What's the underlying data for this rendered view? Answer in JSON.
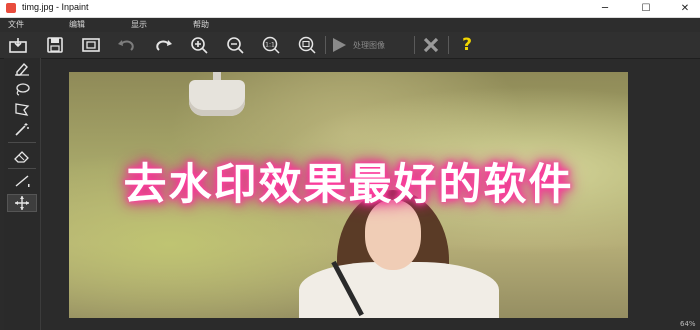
{
  "window": {
    "title": "timg.jpg - Inpaint",
    "minimize": "─",
    "maximize": "☐",
    "close": "✕"
  },
  "menu": {
    "items": [
      "文件",
      "编辑",
      "显示",
      "帮助"
    ]
  },
  "toolbar": {
    "icons": [
      "open-image-icon",
      "save-icon",
      "save-as-icon",
      "undo-icon",
      "redo-icon",
      "zoom-in-icon",
      "zoom-out-icon",
      "actual-size-icon",
      "fit-window-icon",
      "process-icon",
      "cancel-icon",
      "help-icon"
    ],
    "process_label": "处理图像",
    "help_label": "?"
  },
  "left_tools": {
    "icons": [
      "marker-icon",
      "lasso-icon",
      "polygon-lasso-icon",
      "magic-wand-icon",
      "eraser-icon",
      "line-icon",
      "move-icon"
    ],
    "active": "move-icon"
  },
  "canvas": {
    "watermark_text": "去水印效果最好的软件"
  },
  "status": {
    "zoom": "64%"
  },
  "colors": {
    "accent_yellow": "#f2d600",
    "watermark_glow": "#ff3fa0"
  }
}
